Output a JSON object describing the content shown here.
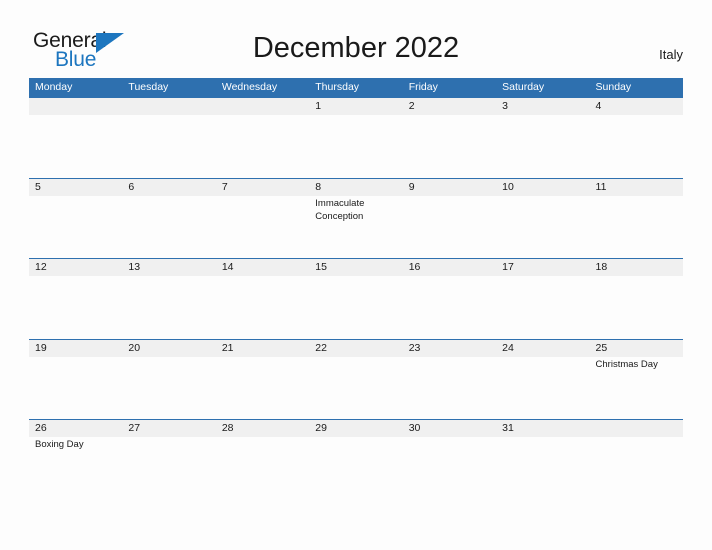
{
  "brand": {
    "word1": "General",
    "word2": "Blue",
    "accent_color": "#1d76bf",
    "triangle_icon": "triangle-flag-icon"
  },
  "header": {
    "title": "December 2022",
    "country": "Italy",
    "header_band_color": "#2e70af",
    "daynum_band_color": "#f0f0f0"
  },
  "calendar": {
    "weekdays": [
      "Monday",
      "Tuesday",
      "Wednesday",
      "Thursday",
      "Friday",
      "Saturday",
      "Sunday"
    ],
    "weeks": [
      [
        {
          "date": "",
          "event": ""
        },
        {
          "date": "",
          "event": ""
        },
        {
          "date": "",
          "event": ""
        },
        {
          "date": "1",
          "event": ""
        },
        {
          "date": "2",
          "event": ""
        },
        {
          "date": "3",
          "event": ""
        },
        {
          "date": "4",
          "event": ""
        }
      ],
      [
        {
          "date": "5",
          "event": ""
        },
        {
          "date": "6",
          "event": ""
        },
        {
          "date": "7",
          "event": ""
        },
        {
          "date": "8",
          "event": "Immaculate Conception"
        },
        {
          "date": "9",
          "event": ""
        },
        {
          "date": "10",
          "event": ""
        },
        {
          "date": "11",
          "event": ""
        }
      ],
      [
        {
          "date": "12",
          "event": ""
        },
        {
          "date": "13",
          "event": ""
        },
        {
          "date": "14",
          "event": ""
        },
        {
          "date": "15",
          "event": ""
        },
        {
          "date": "16",
          "event": ""
        },
        {
          "date": "17",
          "event": ""
        },
        {
          "date": "18",
          "event": ""
        }
      ],
      [
        {
          "date": "19",
          "event": ""
        },
        {
          "date": "20",
          "event": ""
        },
        {
          "date": "21",
          "event": ""
        },
        {
          "date": "22",
          "event": ""
        },
        {
          "date": "23",
          "event": ""
        },
        {
          "date": "24",
          "event": ""
        },
        {
          "date": "25",
          "event": "Christmas Day"
        }
      ],
      [
        {
          "date": "26",
          "event": "Boxing Day"
        },
        {
          "date": "27",
          "event": ""
        },
        {
          "date": "28",
          "event": ""
        },
        {
          "date": "29",
          "event": ""
        },
        {
          "date": "30",
          "event": ""
        },
        {
          "date": "31",
          "event": ""
        },
        {
          "date": "",
          "event": ""
        }
      ]
    ]
  }
}
